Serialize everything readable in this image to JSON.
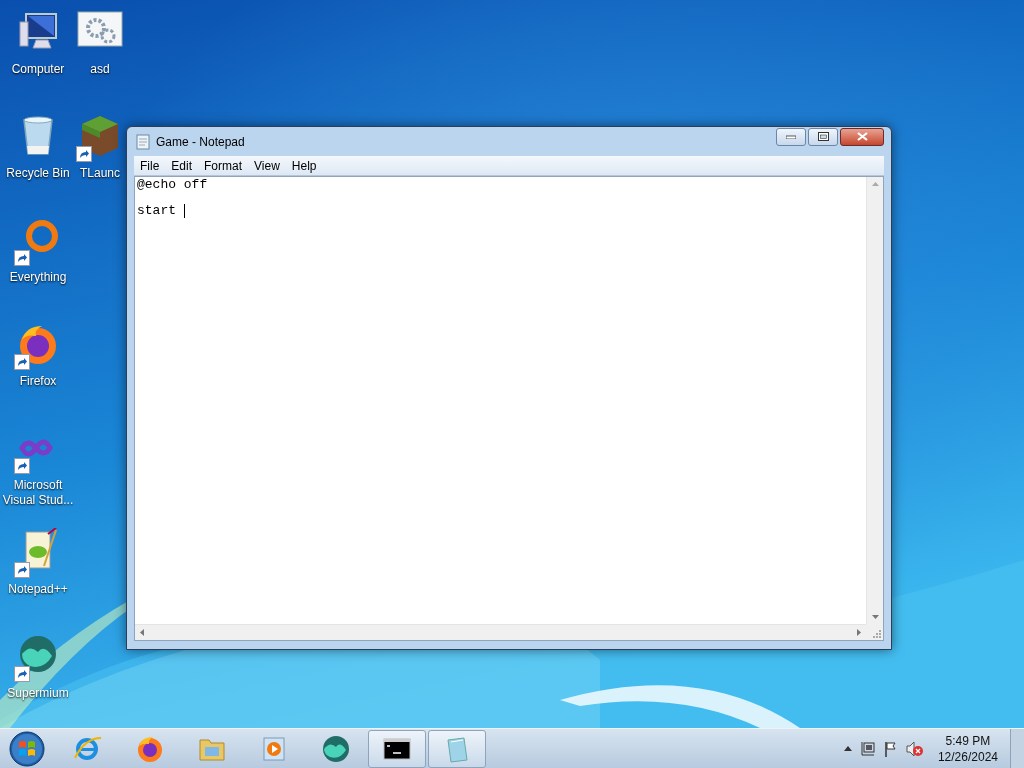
{
  "desktop": {
    "icon_columns": [
      [
        {
          "label": "Computer",
          "kind": "computer",
          "shortcut": false
        },
        {
          "label": "Recycle Bin",
          "kind": "recycle",
          "shortcut": false
        },
        {
          "label": "Everything",
          "kind": "everything",
          "shortcut": true
        },
        {
          "label": "Firefox",
          "kind": "firefox",
          "shortcut": true
        },
        {
          "label": "Microsoft Visual Stud...",
          "kind": "vs",
          "shortcut": true
        },
        {
          "label": "Notepad++",
          "kind": "notepadpp",
          "shortcut": true
        },
        {
          "label": "Supermium",
          "kind": "supermium",
          "shortcut": true
        }
      ],
      [
        {
          "label": "asd",
          "kind": "settings",
          "shortcut": false
        },
        {
          "label": "TLaunc",
          "kind": "block",
          "shortcut": true
        }
      ]
    ]
  },
  "window": {
    "title": "Game - Notepad",
    "menu": [
      "File",
      "Edit",
      "Format",
      "View",
      "Help"
    ],
    "text": "@echo off\n\nstart "
  },
  "taskbar": {
    "items": [
      {
        "kind": "ie",
        "open": false
      },
      {
        "kind": "firefox",
        "open": false
      },
      {
        "kind": "folder",
        "open": false
      },
      {
        "kind": "media",
        "open": false
      },
      {
        "kind": "supermium",
        "open": false
      },
      {
        "kind": "cmd",
        "open": true
      },
      {
        "kind": "notepad",
        "open": true
      }
    ],
    "clock": {
      "time": "5:49 PM",
      "date": "12/26/2024"
    }
  }
}
